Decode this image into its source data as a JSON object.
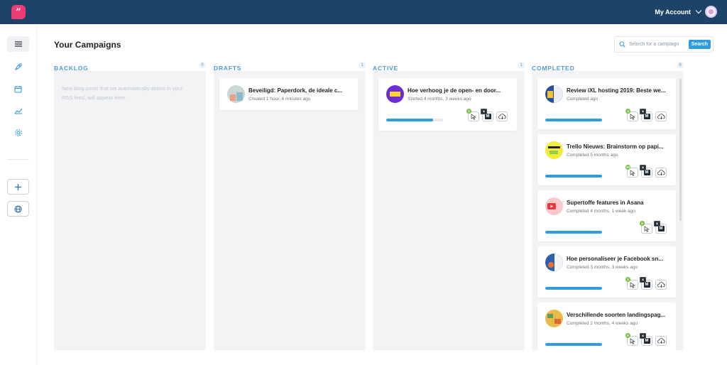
{
  "app": {
    "logo_icon": "quote-icon",
    "account_label": "My Account"
  },
  "sidebar": {
    "items": [
      "menu-icon",
      "rocket-icon",
      "calendar-icon",
      "chart-icon",
      "settings-icon",
      "plus-icon",
      "globe-icon"
    ]
  },
  "main": {
    "title": "Your Campaigns",
    "search": {
      "placeholder": "Search for a campaign",
      "button": "Search"
    }
  },
  "columns": {
    "backlog": {
      "title": "BACKLOG",
      "count": "0",
      "empty_text": "New blog posts that we automatically detect in your RSS feed, will appear here."
    },
    "drafts": {
      "title": "DRAFTS",
      "count": "1",
      "cards": [
        {
          "title": "Beveiligd: Paperdork, de ideale c...",
          "subtitle": "Created 1 hour, 6 minutes ago"
        }
      ]
    },
    "active": {
      "title": "ACTIVE",
      "count": "1",
      "cards": [
        {
          "title": "Hoe verhoog je de open- en door...",
          "subtitle": "Started 4 months, 3 weeks ago",
          "progress": 0.82,
          "badge": "2"
        }
      ]
    },
    "completed": {
      "title": "COMPLETED",
      "count": "9",
      "cards": [
        {
          "title": "Review iXL hosting 2019: Beste we...",
          "subtitle": "Completed ago",
          "badge": "4"
        },
        {
          "title": "Trello Nieuws: Brainstorm op papi...",
          "subtitle": "Completed 5 months ago",
          "badge": "10"
        },
        {
          "title": "Supertoffe features in Asana",
          "subtitle": "Completed 4 months, 1 week ago",
          "badge": "5"
        },
        {
          "title": "Hoe personaliseer je Facebook sn...",
          "subtitle": "Completed 3 months, 3 weeks ago",
          "badge": "3"
        },
        {
          "title": "Verschillende soorten landingspag...",
          "subtitle": "Completed 2 months, 4 weeks ago",
          "badge": "5"
        }
      ]
    }
  },
  "card_icons": {
    "clicks": "cursor-icon",
    "medium": "M",
    "download": "cloud-download-icon"
  },
  "colors": {
    "topbar": "#1d4468",
    "accent": "#2f9be0",
    "logo": "#f03a73",
    "badge": "#7ac143"
  }
}
